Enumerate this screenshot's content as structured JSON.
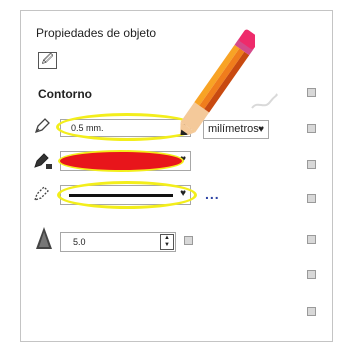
{
  "panel": {
    "title": "Propiedades de objeto",
    "object_button_icon": "pen-nib-icon",
    "section_title": "Contorno"
  },
  "outline": {
    "width_value": "0.5 mm.",
    "units_value": "milímetros",
    "more_options": "...",
    "outline_color": "#e8151b",
    "line_style": "solid",
    "highlight_color": "#f3ee1b"
  },
  "miter": {
    "value": "5.0"
  },
  "icons": {
    "width": "pen-outline-icon",
    "color": "pen-fill-icon",
    "style": "pen-dotted-icon",
    "miter": "miter-limit-icon",
    "pointer": "pencil-icon"
  }
}
